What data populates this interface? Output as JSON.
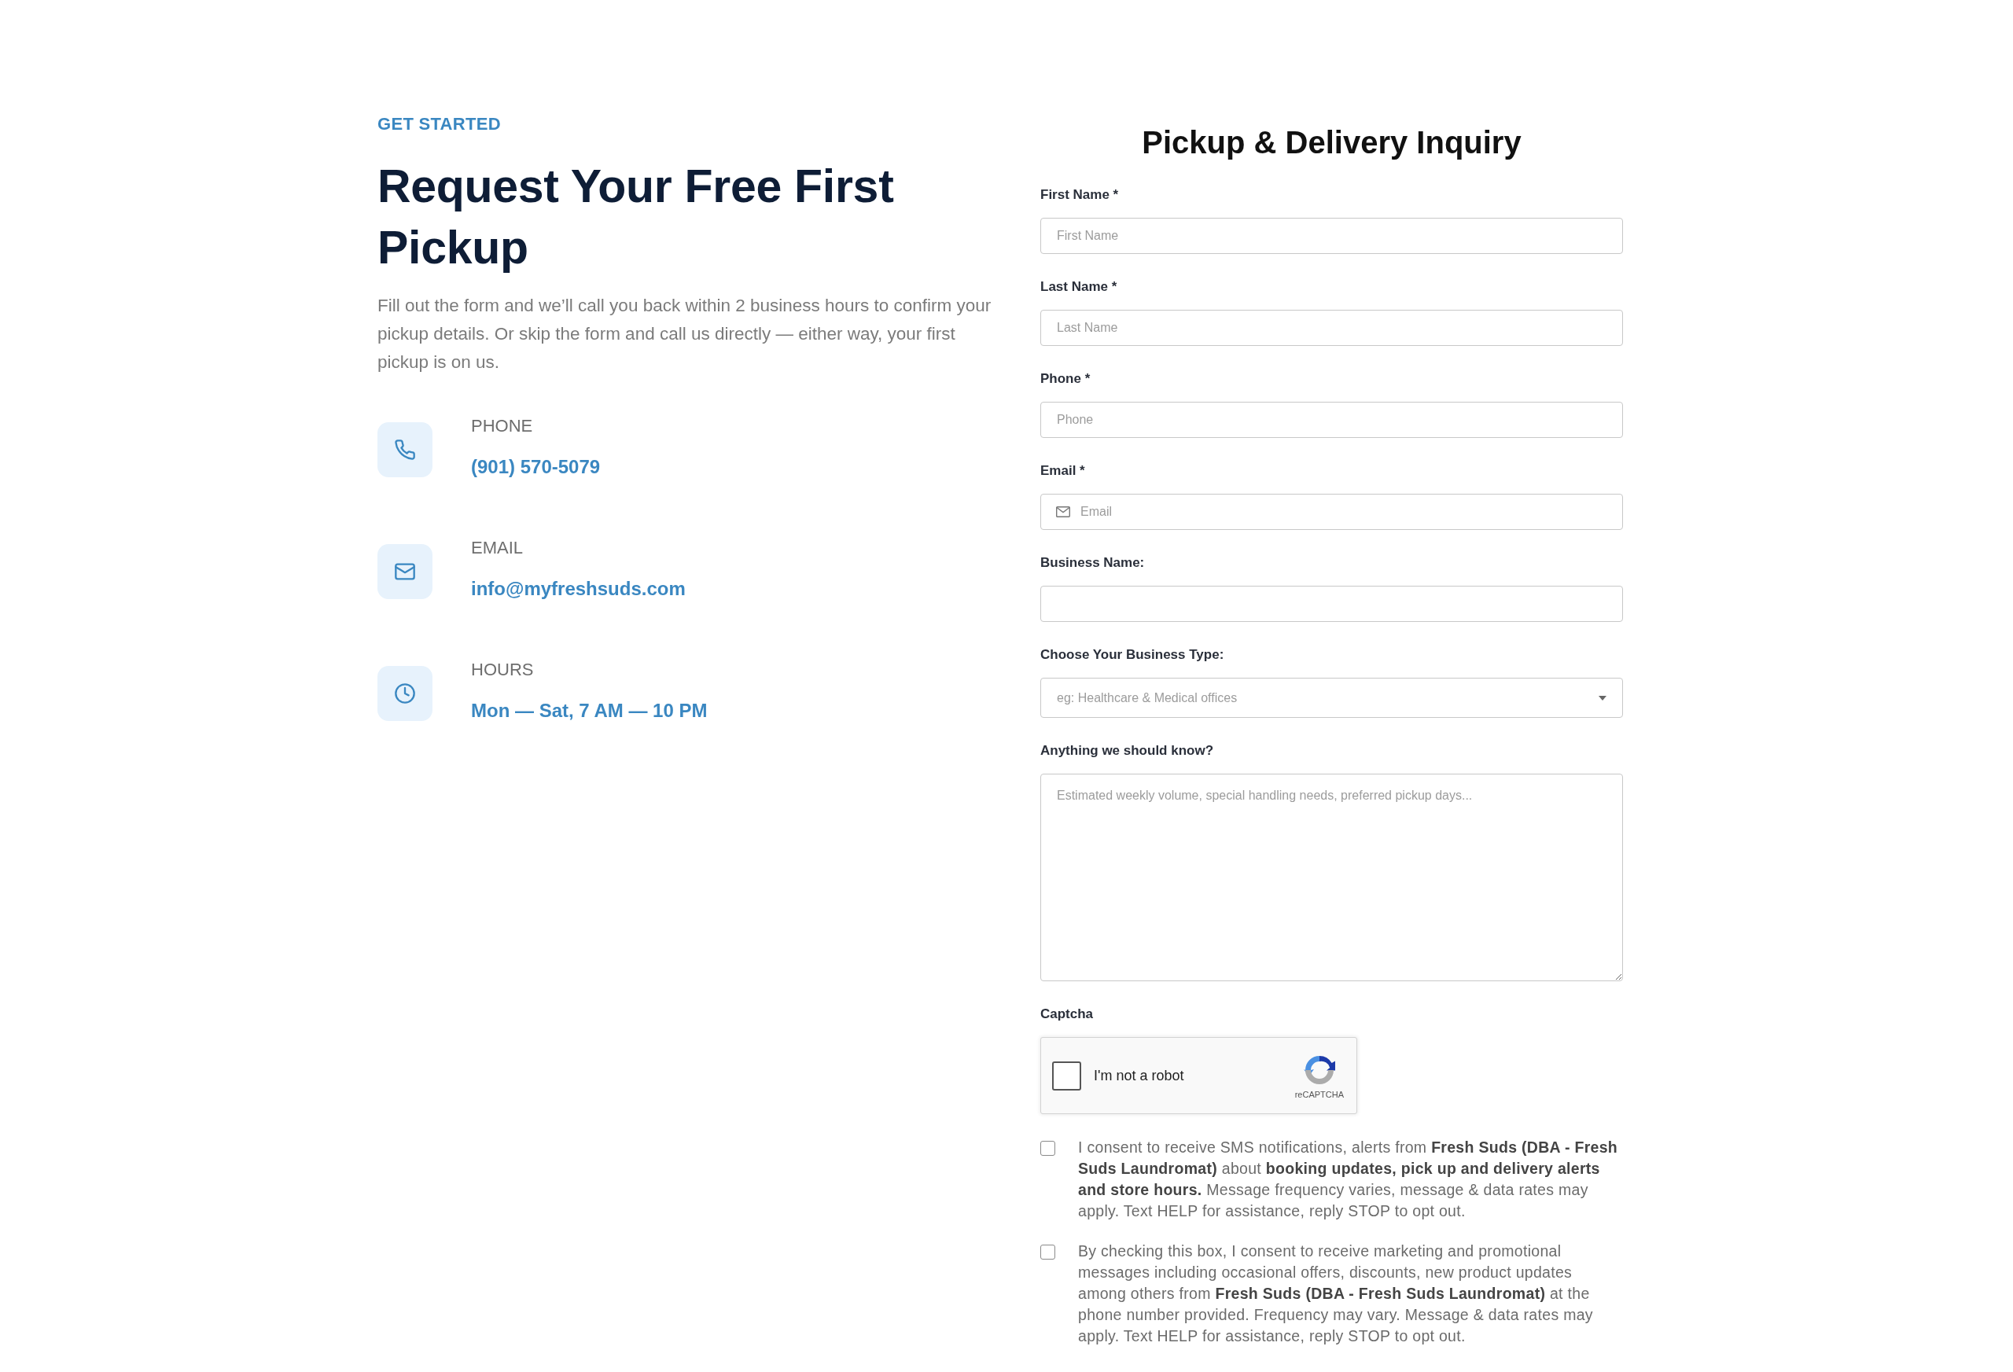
{
  "intro": {
    "eyebrow": "GET STARTED",
    "title": "Request Your Free First Pickup",
    "description": "Fill out the form and we’ll call you back within 2 business hours to confirm your pickup details. Or skip the form and call us directly — either way, your first pickup is on us."
  },
  "contacts": [
    {
      "kind": "phone",
      "label": "PHONE",
      "value": "(901) 570-5079"
    },
    {
      "kind": "email",
      "label": "EMAIL",
      "value": "info@myfreshsuds.com"
    },
    {
      "kind": "hours",
      "label": "HOURS",
      "value": "Mon — Sat, 7 AM — 10 PM"
    }
  ],
  "form": {
    "title": "Pickup & Delivery Inquiry",
    "fields": [
      {
        "kind": "text",
        "label": "First Name *",
        "placeholder": "First Name"
      },
      {
        "kind": "text",
        "label": "Last Name *",
        "placeholder": "Last Name"
      },
      {
        "kind": "text",
        "label": "Phone *",
        "placeholder": "Phone"
      },
      {
        "kind": "email",
        "label": "Email *",
        "placeholder": "Email"
      },
      {
        "kind": "text",
        "label": "Business Name:"
      },
      {
        "kind": "select",
        "label": "Choose Your Business Type:",
        "placeholder": "eg: Healthcare & Medical offices"
      },
      {
        "kind": "textarea",
        "label": "Anything we should know?",
        "placeholder": "Estimated weekly volume, special handling needs, preferred pickup days..."
      }
    ],
    "captcha": {
      "label": "Captcha",
      "checkbox_label": "I'm not a robot",
      "checked": false,
      "brand": "reCAPTCHA"
    },
    "consents": [
      {
        "checked": false,
        "text": "I consent to receive SMS notifications, alerts from **Fresh Suds (DBA - Fresh Suds Laundromat)** about **booking updates, pick up and delivery alerts and store hours.** Message frequency varies, message & data rates may apply. Text HELP for assistance, reply STOP to opt out."
      },
      {
        "checked": false,
        "text": "By checking this box, I consent to receive marketing and promotional messages including occasional offers, discounts, new product updates among others from **Fresh Suds (DBA - Fresh Suds Laundromat)** at the phone number provided. Frequency may vary. Message & data rates may apply. Text HELP for assistance, reply STOP to opt out."
      }
    ]
  }
}
